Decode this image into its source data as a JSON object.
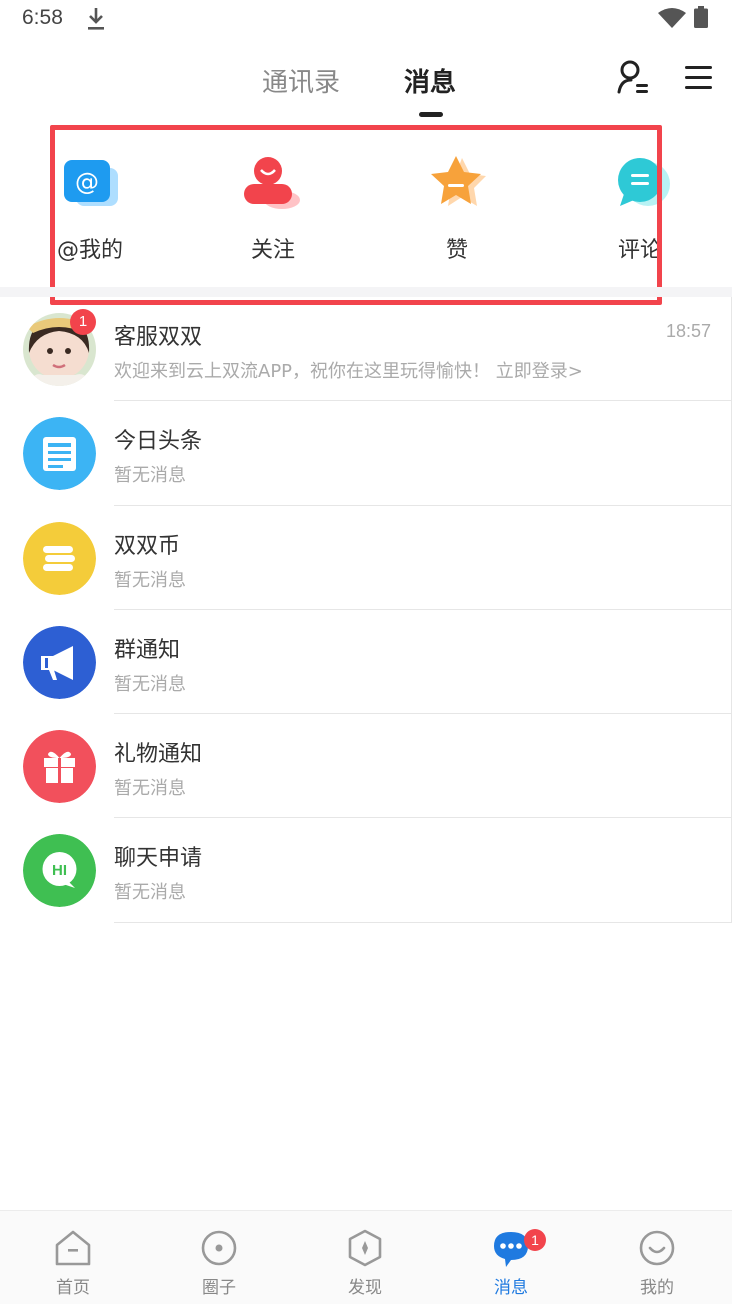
{
  "status_bar": {
    "time": "6:58"
  },
  "header": {
    "tabs": [
      {
        "label": "通讯录",
        "active": false
      },
      {
        "label": "消息",
        "active": true
      }
    ]
  },
  "quick_actions": [
    {
      "label": "@我的",
      "icon": "at-icon",
      "color": "#1e9bf0"
    },
    {
      "label": "关注",
      "icon": "follow-user-icon",
      "color": "#f2444c"
    },
    {
      "label": "赞",
      "icon": "star-like-icon",
      "color": "#f7a23b"
    },
    {
      "label": "评论",
      "icon": "comment-bubble-icon",
      "color": "#2ec9d6"
    }
  ],
  "messages": [
    {
      "title": "客服双双",
      "preview": "欢迎来到云上双流APP，祝你在这里玩得愉快！ 立即登录>",
      "time": "18:57",
      "badge": "1",
      "icon": "girl-avatar"
    },
    {
      "title": "今日头条",
      "preview": "暂无消息",
      "icon": "newspaper-icon",
      "color": "#3cb4f4"
    },
    {
      "title": "双双币",
      "preview": "暂无消息",
      "icon": "coin-stack-icon",
      "color": "#f4cc3a"
    },
    {
      "title": "群通知",
      "preview": "暂无消息",
      "icon": "megaphone-icon",
      "color": "#2d5fd3"
    },
    {
      "title": "礼物通知",
      "preview": "暂无消息",
      "icon": "gift-icon",
      "color": "#f2505c"
    },
    {
      "title": "聊天申请",
      "preview": "暂无消息",
      "icon": "hi-chat-icon",
      "color": "#3fbf52"
    }
  ],
  "bottom_nav": [
    {
      "label": "首页",
      "icon": "home-icon",
      "active": false
    },
    {
      "label": "圈子",
      "icon": "circle-icon",
      "active": false
    },
    {
      "label": "发现",
      "icon": "compass-icon",
      "active": false
    },
    {
      "label": "消息",
      "icon": "message-icon",
      "active": true,
      "badge": "1"
    },
    {
      "label": "我的",
      "icon": "profile-icon",
      "active": false
    }
  ],
  "colors": {
    "accent": "#1f7ae0",
    "highlight": "#f2444c"
  }
}
